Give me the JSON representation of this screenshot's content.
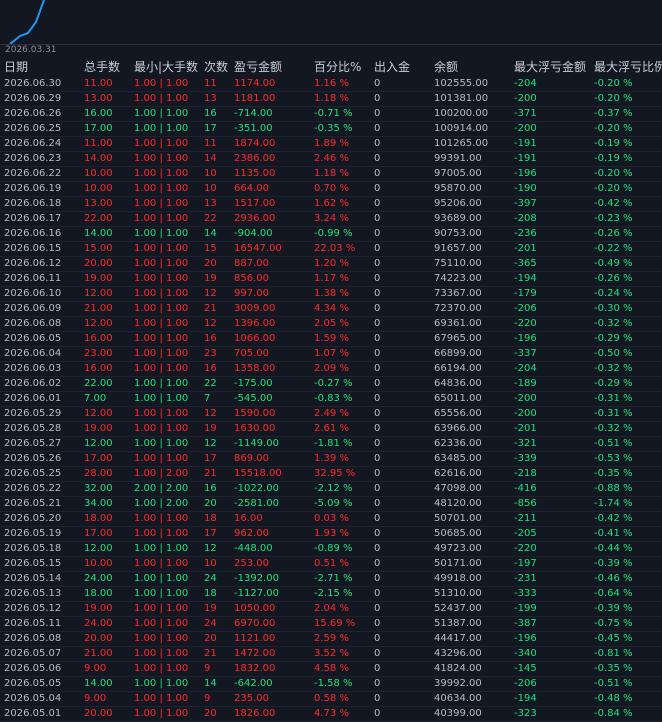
{
  "chart": {
    "start_date": "2026.03.31",
    "line_color": "#2196f3"
  },
  "colors": {
    "profit": "#ff2a2a",
    "loss": "#22e07a",
    "background": "#131722"
  },
  "table": {
    "headers": [
      "日期",
      "总手数",
      "最小|大手数",
      "次数",
      "盈亏金额",
      "百分比%",
      "出入金",
      "余额",
      "最大浮亏金额",
      "最大浮亏比例"
    ],
    "rows": [
      {
        "date": "2026.06.30",
        "lots": "11.00",
        "range": "1.00 | 1.00",
        "count": "11",
        "pnl": "1174.00",
        "pct": "1.16 %",
        "io": "0",
        "balance": "102555.00",
        "max_dd": "-204",
        "max_dd_pct": "-0.20 %",
        "sign": "pos"
      },
      {
        "date": "2026.06.29",
        "lots": "13.00",
        "range": "1.00 | 1.00",
        "count": "13",
        "pnl": "1181.00",
        "pct": "1.18 %",
        "io": "0",
        "balance": "101381.00",
        "max_dd": "-200",
        "max_dd_pct": "-0.20 %",
        "sign": "pos"
      },
      {
        "date": "2026.06.26",
        "lots": "16.00",
        "range": "1.00 | 1.00",
        "count": "16",
        "pnl": "-714.00",
        "pct": "-0.71 %",
        "io": "0",
        "balance": "100200.00",
        "max_dd": "-371",
        "max_dd_pct": "-0.37 %",
        "sign": "neg"
      },
      {
        "date": "2026.06.25",
        "lots": "17.00",
        "range": "1.00 | 1.00",
        "count": "17",
        "pnl": "-351.00",
        "pct": "-0.35 %",
        "io": "0",
        "balance": "100914.00",
        "max_dd": "-200",
        "max_dd_pct": "-0.20 %",
        "sign": "neg"
      },
      {
        "date": "2026.06.24",
        "lots": "11.00",
        "range": "1.00 | 1.00",
        "count": "11",
        "pnl": "1874.00",
        "pct": "1.89 %",
        "io": "0",
        "balance": "101265.00",
        "max_dd": "-191",
        "max_dd_pct": "-0.19 %",
        "sign": "pos"
      },
      {
        "date": "2026.06.23",
        "lots": "14.00",
        "range": "1.00 | 1.00",
        "count": "14",
        "pnl": "2386.00",
        "pct": "2.46 %",
        "io": "0",
        "balance": "99391.00",
        "max_dd": "-191",
        "max_dd_pct": "-0.19 %",
        "sign": "pos"
      },
      {
        "date": "2026.06.22",
        "lots": "10.00",
        "range": "1.00 | 1.00",
        "count": "10",
        "pnl": "1135.00",
        "pct": "1.18 %",
        "io": "0",
        "balance": "97005.00",
        "max_dd": "-196",
        "max_dd_pct": "-0.20 %",
        "sign": "pos"
      },
      {
        "date": "2026.06.19",
        "lots": "10.00",
        "range": "1.00 | 1.00",
        "count": "10",
        "pnl": "664.00",
        "pct": "0.70 %",
        "io": "0",
        "balance": "95870.00",
        "max_dd": "-190",
        "max_dd_pct": "-0.20 %",
        "sign": "pos"
      },
      {
        "date": "2026.06.18",
        "lots": "13.00",
        "range": "1.00 | 1.00",
        "count": "13",
        "pnl": "1517.00",
        "pct": "1.62 %",
        "io": "0",
        "balance": "95206.00",
        "max_dd": "-397",
        "max_dd_pct": "-0.42 %",
        "sign": "pos"
      },
      {
        "date": "2026.06.17",
        "lots": "22.00",
        "range": "1.00 | 1.00",
        "count": "22",
        "pnl": "2936.00",
        "pct": "3.24 %",
        "io": "0",
        "balance": "93689.00",
        "max_dd": "-208",
        "max_dd_pct": "-0.23 %",
        "sign": "pos"
      },
      {
        "date": "2026.06.16",
        "lots": "14.00",
        "range": "1.00 | 1.00",
        "count": "14",
        "pnl": "-904.00",
        "pct": "-0.99 %",
        "io": "0",
        "balance": "90753.00",
        "max_dd": "-236",
        "max_dd_pct": "-0.26 %",
        "sign": "neg"
      },
      {
        "date": "2026.06.15",
        "lots": "15.00",
        "range": "1.00 | 1.00",
        "count": "15",
        "pnl": "16547.00",
        "pct": "22.03 %",
        "io": "0",
        "balance": "91657.00",
        "max_dd": "-201",
        "max_dd_pct": "-0.22 %",
        "sign": "pos"
      },
      {
        "date": "2026.06.12",
        "lots": "20.00",
        "range": "1.00 | 1.00",
        "count": "20",
        "pnl": "887.00",
        "pct": "1.20 %",
        "io": "0",
        "balance": "75110.00",
        "max_dd": "-365",
        "max_dd_pct": "-0.49 %",
        "sign": "pos"
      },
      {
        "date": "2026.06.11",
        "lots": "19.00",
        "range": "1.00 | 1.00",
        "count": "19",
        "pnl": "856.00",
        "pct": "1.17 %",
        "io": "0",
        "balance": "74223.00",
        "max_dd": "-194",
        "max_dd_pct": "-0.26 %",
        "sign": "pos"
      },
      {
        "date": "2026.06.10",
        "lots": "12.00",
        "range": "1.00 | 1.00",
        "count": "12",
        "pnl": "997.00",
        "pct": "1.38 %",
        "io": "0",
        "balance": "73367.00",
        "max_dd": "-179",
        "max_dd_pct": "-0.24 %",
        "sign": "pos"
      },
      {
        "date": "2026.06.09",
        "lots": "21.00",
        "range": "1.00 | 1.00",
        "count": "21",
        "pnl": "3009.00",
        "pct": "4.34 %",
        "io": "0",
        "balance": "72370.00",
        "max_dd": "-206",
        "max_dd_pct": "-0.30 %",
        "sign": "pos"
      },
      {
        "date": "2026.06.08",
        "lots": "12.00",
        "range": "1.00 | 1.00",
        "count": "12",
        "pnl": "1396.00",
        "pct": "2.05 %",
        "io": "0",
        "balance": "69361.00",
        "max_dd": "-220",
        "max_dd_pct": "-0.32 %",
        "sign": "pos"
      },
      {
        "date": "2026.06.05",
        "lots": "16.00",
        "range": "1.00 | 1.00",
        "count": "16",
        "pnl": "1066.00",
        "pct": "1.59 %",
        "io": "0",
        "balance": "67965.00",
        "max_dd": "-196",
        "max_dd_pct": "-0.29 %",
        "sign": "pos"
      },
      {
        "date": "2026.06.04",
        "lots": "23.00",
        "range": "1.00 | 1.00",
        "count": "23",
        "pnl": "705.00",
        "pct": "1.07 %",
        "io": "0",
        "balance": "66899.00",
        "max_dd": "-337",
        "max_dd_pct": "-0.50 %",
        "sign": "pos"
      },
      {
        "date": "2026.06.03",
        "lots": "16.00",
        "range": "1.00 | 1.00",
        "count": "16",
        "pnl": "1358.00",
        "pct": "2.09 %",
        "io": "0",
        "balance": "66194.00",
        "max_dd": "-204",
        "max_dd_pct": "-0.32 %",
        "sign": "pos"
      },
      {
        "date": "2026.06.02",
        "lots": "22.00",
        "range": "1.00 | 1.00",
        "count": "22",
        "pnl": "-175.00",
        "pct": "-0.27 %",
        "io": "0",
        "balance": "64836.00",
        "max_dd": "-189",
        "max_dd_pct": "-0.29 %",
        "sign": "neg"
      },
      {
        "date": "2026.06.01",
        "lots": "7.00",
        "range": "1.00 | 1.00",
        "count": "7",
        "pnl": "-545.00",
        "pct": "-0.83 %",
        "io": "0",
        "balance": "65011.00",
        "max_dd": "-200",
        "max_dd_pct": "-0.31 %",
        "sign": "neg"
      },
      {
        "date": "2026.05.29",
        "lots": "12.00",
        "range": "1.00 | 1.00",
        "count": "12",
        "pnl": "1590.00",
        "pct": "2.49 %",
        "io": "0",
        "balance": "65556.00",
        "max_dd": "-200",
        "max_dd_pct": "-0.31 %",
        "sign": "pos"
      },
      {
        "date": "2026.05.28",
        "lots": "19.00",
        "range": "1.00 | 1.00",
        "count": "19",
        "pnl": "1630.00",
        "pct": "2.61 %",
        "io": "0",
        "balance": "63966.00",
        "max_dd": "-201",
        "max_dd_pct": "-0.32 %",
        "sign": "pos"
      },
      {
        "date": "2026.05.27",
        "lots": "12.00",
        "range": "1.00 | 1.00",
        "count": "12",
        "pnl": "-1149.00",
        "pct": "-1.81 %",
        "io": "0",
        "balance": "62336.00",
        "max_dd": "-321",
        "max_dd_pct": "-0.51 %",
        "sign": "neg"
      },
      {
        "date": "2026.05.26",
        "lots": "17.00",
        "range": "1.00 | 1.00",
        "count": "17",
        "pnl": "869.00",
        "pct": "1.39 %",
        "io": "0",
        "balance": "63485.00",
        "max_dd": "-339",
        "max_dd_pct": "-0.53 %",
        "sign": "pos"
      },
      {
        "date": "2026.05.25",
        "lots": "28.00",
        "range": "1.00 | 2.00",
        "count": "21",
        "pnl": "15518.00",
        "pct": "32.95 %",
        "io": "0",
        "balance": "62616.00",
        "max_dd": "-218",
        "max_dd_pct": "-0.35 %",
        "sign": "pos"
      },
      {
        "date": "2026.05.22",
        "lots": "32.00",
        "range": "2.00 | 2.00",
        "count": "16",
        "pnl": "-1022.00",
        "pct": "-2.12 %",
        "io": "0",
        "balance": "47098.00",
        "max_dd": "-416",
        "max_dd_pct": "-0.88 %",
        "sign": "neg"
      },
      {
        "date": "2026.05.21",
        "lots": "34.00",
        "range": "1.00 | 2.00",
        "count": "20",
        "pnl": "-2581.00",
        "pct": "-5.09 %",
        "io": "0",
        "balance": "48120.00",
        "max_dd": "-856",
        "max_dd_pct": "-1.74 %",
        "sign": "neg"
      },
      {
        "date": "2026.05.20",
        "lots": "18.00",
        "range": "1.00 | 1.00",
        "count": "18",
        "pnl": "16.00",
        "pct": "0.03 %",
        "io": "0",
        "balance": "50701.00",
        "max_dd": "-211",
        "max_dd_pct": "-0.42 %",
        "sign": "pos"
      },
      {
        "date": "2026.05.19",
        "lots": "17.00",
        "range": "1.00 | 1.00",
        "count": "17",
        "pnl": "962.00",
        "pct": "1.93 %",
        "io": "0",
        "balance": "50685.00",
        "max_dd": "-205",
        "max_dd_pct": "-0.41 %",
        "sign": "pos"
      },
      {
        "date": "2026.05.18",
        "lots": "12.00",
        "range": "1.00 | 1.00",
        "count": "12",
        "pnl": "-448.00",
        "pct": "-0.89 %",
        "io": "0",
        "balance": "49723.00",
        "max_dd": "-220",
        "max_dd_pct": "-0.44 %",
        "sign": "neg"
      },
      {
        "date": "2026.05.15",
        "lots": "10.00",
        "range": "1.00 | 1.00",
        "count": "10",
        "pnl": "253.00",
        "pct": "0.51 %",
        "io": "0",
        "balance": "50171.00",
        "max_dd": "-197",
        "max_dd_pct": "-0.39 %",
        "sign": "pos"
      },
      {
        "date": "2026.05.14",
        "lots": "24.00",
        "range": "1.00 | 1.00",
        "count": "24",
        "pnl": "-1392.00",
        "pct": "-2.71 %",
        "io": "0",
        "balance": "49918.00",
        "max_dd": "-231",
        "max_dd_pct": "-0.46 %",
        "sign": "neg"
      },
      {
        "date": "2026.05.13",
        "lots": "18.00",
        "range": "1.00 | 1.00",
        "count": "18",
        "pnl": "-1127.00",
        "pct": "-2.15 %",
        "io": "0",
        "balance": "51310.00",
        "max_dd": "-333",
        "max_dd_pct": "-0.64 %",
        "sign": "neg"
      },
      {
        "date": "2026.05.12",
        "lots": "19.00",
        "range": "1.00 | 1.00",
        "count": "19",
        "pnl": "1050.00",
        "pct": "2.04 %",
        "io": "0",
        "balance": "52437.00",
        "max_dd": "-199",
        "max_dd_pct": "-0.39 %",
        "sign": "pos"
      },
      {
        "date": "2026.05.11",
        "lots": "24.00",
        "range": "1.00 | 1.00",
        "count": "24",
        "pnl": "6970.00",
        "pct": "15.69 %",
        "io": "0",
        "balance": "51387.00",
        "max_dd": "-387",
        "max_dd_pct": "-0.75 %",
        "sign": "pos"
      },
      {
        "date": "2026.05.08",
        "lots": "20.00",
        "range": "1.00 | 1.00",
        "count": "20",
        "pnl": "1121.00",
        "pct": "2.59 %",
        "io": "0",
        "balance": "44417.00",
        "max_dd": "-196",
        "max_dd_pct": "-0.45 %",
        "sign": "pos"
      },
      {
        "date": "2026.05.07",
        "lots": "21.00",
        "range": "1.00 | 1.00",
        "count": "21",
        "pnl": "1472.00",
        "pct": "3.52 %",
        "io": "0",
        "balance": "43296.00",
        "max_dd": "-340",
        "max_dd_pct": "-0.81 %",
        "sign": "pos"
      },
      {
        "date": "2026.05.06",
        "lots": "9.00",
        "range": "1.00 | 1.00",
        "count": "9",
        "pnl": "1832.00",
        "pct": "4.58 %",
        "io": "0",
        "balance": "41824.00",
        "max_dd": "-145",
        "max_dd_pct": "-0.35 %",
        "sign": "pos"
      },
      {
        "date": "2026.05.05",
        "lots": "14.00",
        "range": "1.00 | 1.00",
        "count": "14",
        "pnl": "-642.00",
        "pct": "-1.58 %",
        "io": "0",
        "balance": "39992.00",
        "max_dd": "-206",
        "max_dd_pct": "-0.51 %",
        "sign": "neg"
      },
      {
        "date": "2026.05.04",
        "lots": "9.00",
        "range": "1.00 | 1.00",
        "count": "9",
        "pnl": "235.00",
        "pct": "0.58 %",
        "io": "0",
        "balance": "40634.00",
        "max_dd": "-194",
        "max_dd_pct": "-0.48 %",
        "sign": "pos"
      },
      {
        "date": "2026.05.01",
        "lots": "20.00",
        "range": "1.00 | 1.00",
        "count": "20",
        "pnl": "1826.00",
        "pct": "4.73 %",
        "io": "0",
        "balance": "40399.00",
        "max_dd": "-323",
        "max_dd_pct": "-0.84 %",
        "sign": "pos"
      }
    ]
  }
}
